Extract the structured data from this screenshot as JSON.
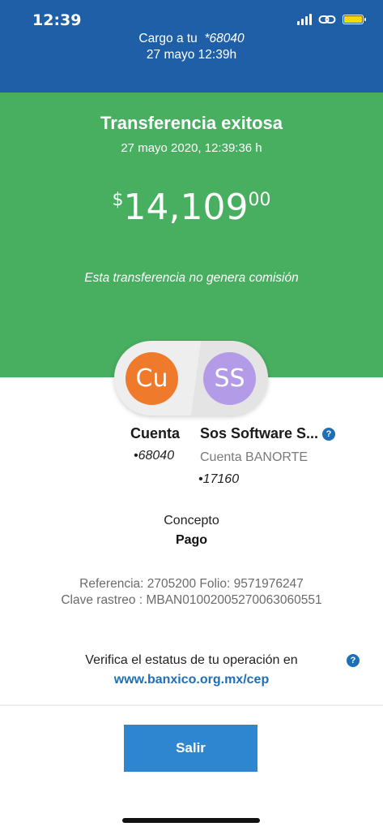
{
  "status_bar": {
    "time": "12:39"
  },
  "header": {
    "cargo_label": "Cargo a tu",
    "cargo_account": "*68040",
    "datetime": "27 mayo 12:39h"
  },
  "result": {
    "title": "Transferencia exitosa",
    "date": "27 mayo 2020, 12:39:36 h",
    "currency_symbol": "$",
    "amount_integer": "14,109",
    "amount_cents": "00",
    "commission_note": "Esta transferencia no genera comisión"
  },
  "origin": {
    "initials": "Cu",
    "name": "Cuenta",
    "account": "68040",
    "bullet": "•"
  },
  "destination": {
    "initials": "SS",
    "name": "Sos Software S...",
    "bank": "Cuenta BANORTE",
    "account": "17160",
    "bullet": "•",
    "help": "?"
  },
  "concept": {
    "label": "Concepto",
    "value": "Pago"
  },
  "reference": {
    "line1": "Referencia: 2705200 Folio: 9571976247",
    "line2": "Clave rastreo : MBAN01002005270063060551"
  },
  "verify": {
    "text": "Verifica el estatus de tu operación en",
    "link": "www.banxico.org.mx/cep",
    "help": "?"
  },
  "actions": {
    "exit_label": "Salir"
  },
  "colors": {
    "header_bg": "#1f5fa8",
    "success_bg": "#48ae60",
    "origin_avatar": "#f07a2c",
    "destination_avatar": "#b49be8",
    "link": "#1f6fb5",
    "button": "#2e86d0"
  }
}
